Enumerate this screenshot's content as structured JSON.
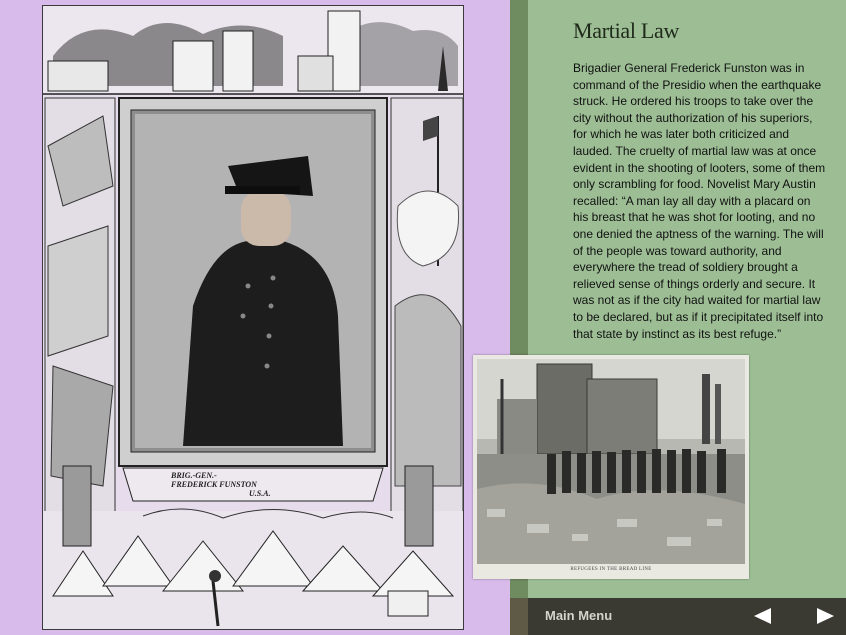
{
  "page": {
    "title": "Martial Law",
    "body": "Brigadier General Frederick Funston was in command of the Presidio when the earthquake struck. He ordered his troops to take over the city without the authorization of his superiors, for which he was later both criticized and lauded. The cruelty of martial law was at once evident in the shooting of looters, some of them only scrambling for food. Novelist Mary Austin recalled: “A man lay all day with a placard on his breast that he was shot for looting, and no one denied the aptness of the warning. The will of the people was toward authority, and everywhere the tread of soldiery brought a relieved sense of things orderly and secure. It was not as if the city had waited for martial law to be declared, but as if it precipitated itself into that state by instinct as its best refuge.”"
  },
  "illustration": {
    "portrait_caption_line1": "BRIG.-GEN.-",
    "portrait_caption_line2": "FREDERICK FUNSTON",
    "portrait_caption_line3": "U.S.A."
  },
  "photo": {
    "caption": "REFUGEES IN THE BREAD LINE"
  },
  "footer": {
    "main_menu_label": "Main Menu",
    "prev_icon": "triangle-left-icon",
    "next_icon": "triangle-right-icon"
  },
  "colors": {
    "left_background": "#d8bbea",
    "right_background": "#9dbe95",
    "footer_background": "#3a3a33"
  }
}
